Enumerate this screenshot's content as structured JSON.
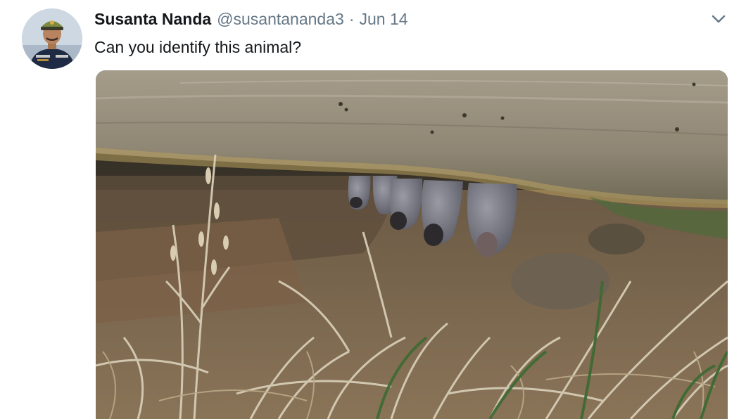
{
  "tweet": {
    "author_name": "Susanta Nanda",
    "handle": "@susantananda3",
    "separator": "·",
    "date": "Jun 14",
    "text": "Can you identify this animal?"
  },
  "icons": {
    "menu": "chevron-down-icon",
    "avatar": "avatar-photo"
  },
  "colors": {
    "text_primary": "#14171a",
    "text_secondary": "#657786"
  }
}
